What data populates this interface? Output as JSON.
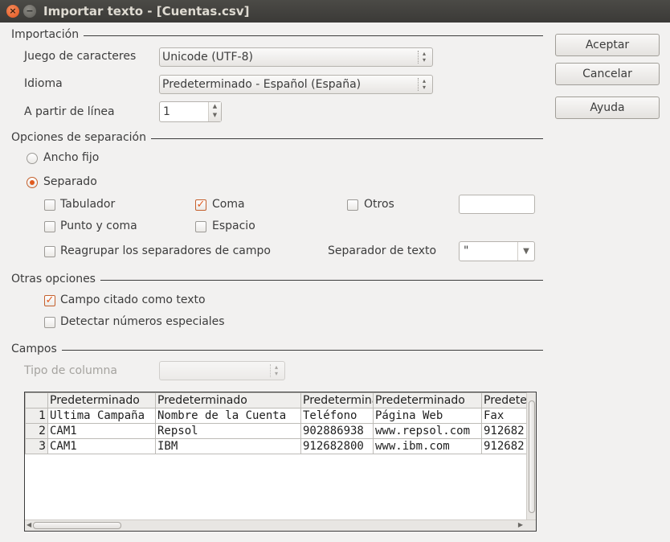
{
  "window": {
    "title": "Importar texto - [Cuentas.csv]"
  },
  "import": {
    "section": "Importación",
    "charset_label": "Juego de caracteres",
    "charset_value": "Unicode (UTF-8)",
    "language_label": "Idioma",
    "language_value": "Predeterminado - Español (España)",
    "from_line_label": "A partir de línea",
    "from_line_value": "1"
  },
  "buttons": {
    "accept": "Aceptar",
    "cancel": "Cancelar",
    "help": "Ayuda"
  },
  "separator": {
    "section": "Opciones de separación",
    "fixed_width": "Ancho fijo",
    "separated": "Separado",
    "mode": "separated",
    "tab": "Tabulador",
    "tab_checked": false,
    "comma": "Coma",
    "comma_checked": true,
    "other": "Otros",
    "other_checked": false,
    "other_value": "",
    "semicolon": "Punto y coma",
    "semicolon_checked": false,
    "space": "Espacio",
    "space_checked": false,
    "merge": "Reagrupar los separadores de campo",
    "merge_checked": false,
    "text_delimiter_label": "Separador de texto",
    "text_delimiter_value": "\""
  },
  "other_options": {
    "section": "Otras opciones",
    "quoted_as_text": "Campo citado como texto",
    "quoted_as_text_checked": true,
    "detect_special": "Detectar números especiales",
    "detect_special_checked": false
  },
  "fields": {
    "section": "Campos",
    "column_type_label": "Tipo de columna",
    "column_type_value": "",
    "headers": [
      "Predeterminado",
      "Predeterminado",
      "Predetermina",
      "Predeterminado",
      "Predete"
    ],
    "rows": [
      {
        "n": "1",
        "cells": [
          "Ultima Campaña",
          "Nombre de la Cuenta",
          "Teléfono",
          "Página Web",
          "Fax"
        ]
      },
      {
        "n": "2",
        "cells": [
          "CAM1",
          "Repsol",
          "902886938",
          "www.repsol.com",
          "912682"
        ]
      },
      {
        "n": "3",
        "cells": [
          "CAM1",
          "IBM",
          "912682800",
          "www.ibm.com",
          "912682"
        ]
      }
    ]
  },
  "colors": {
    "accent": "#e05a1e",
    "titlebar": "#3c3b37"
  }
}
